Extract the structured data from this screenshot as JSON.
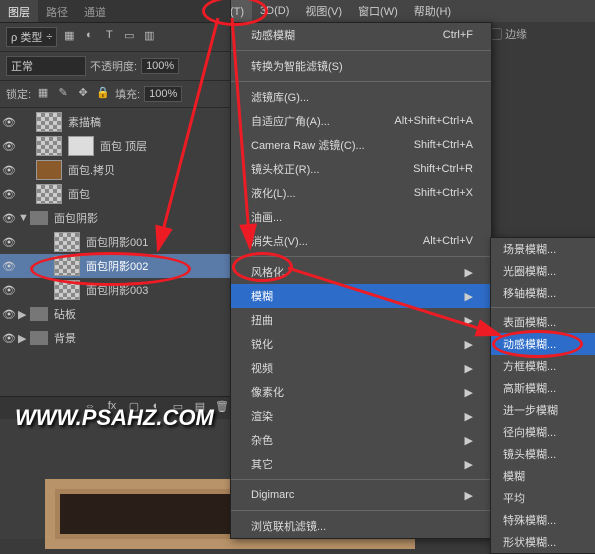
{
  "menubar": {
    "filter": "滤镜(T)",
    "threed": "3D(D)",
    "view": "视图(V)",
    "window": "窗口(W)",
    "help": "帮助(H)"
  },
  "right_options": "边缘",
  "panel": {
    "tabs": {
      "layers": "图层",
      "paths": "路径",
      "channels": "通道"
    },
    "kind": "ρ 类型",
    "mode": "正常",
    "opacity_label": "不透明度:",
    "opacity_val": "100%",
    "lock_label": "锁定:",
    "fill_label": "填充:",
    "fill_val": "100%"
  },
  "layers": {
    "sketch": "素描稿",
    "bread_top": "面包 顶层",
    "bread_copy": "面包.拷贝",
    "bread": "面包",
    "shadow_group": "面包阴影",
    "shadow1": "面包阴影001",
    "shadow2": "面包阴影002",
    "shadow3": "面包阴影003",
    "board": "砧板",
    "bg": "背景"
  },
  "menu": {
    "motion_blur_top": "动感模糊",
    "motion_blur_sc": "Ctrl+F",
    "convert_smart": "转换为智能滤镜(S)",
    "filter_lib": "滤镜库(G)...",
    "adaptive": "自适应广角(A)...",
    "adaptive_sc": "Alt+Shift+Ctrl+A",
    "camera_raw": "Camera Raw 滤镜(C)...",
    "camera_raw_sc": "Shift+Ctrl+A",
    "lens": "镜头校正(R)...",
    "lens_sc": "Shift+Ctrl+R",
    "liquify": "液化(L)...",
    "liquify_sc": "Shift+Ctrl+X",
    "oil": "油画...",
    "vanish": "消失点(V)...",
    "vanish_sc": "Alt+Ctrl+V",
    "stylize": "风格化",
    "blur": "模糊",
    "distort": "扭曲",
    "sharpen": "锐化",
    "video": "视频",
    "pixelate": "像素化",
    "render": "渲染",
    "noise": "杂色",
    "other": "其它",
    "digimarc": "Digimarc",
    "browse": "浏览联机滤镜..."
  },
  "submenu": {
    "field": "场景模糊...",
    "iris": "光圈模糊...",
    "tilt": "移轴模糊...",
    "surface": "表面模糊...",
    "motion": "动感模糊...",
    "box": "方框模糊...",
    "gaussian": "高斯模糊...",
    "further": "进一步模糊",
    "radial": "径向模糊...",
    "lens_blur": "镜头模糊...",
    "blur_only": "模糊",
    "average": "平均",
    "special": "特殊模糊...",
    "shape": "形状模糊..."
  },
  "watermark": "WWW.PSAHZ.COM"
}
